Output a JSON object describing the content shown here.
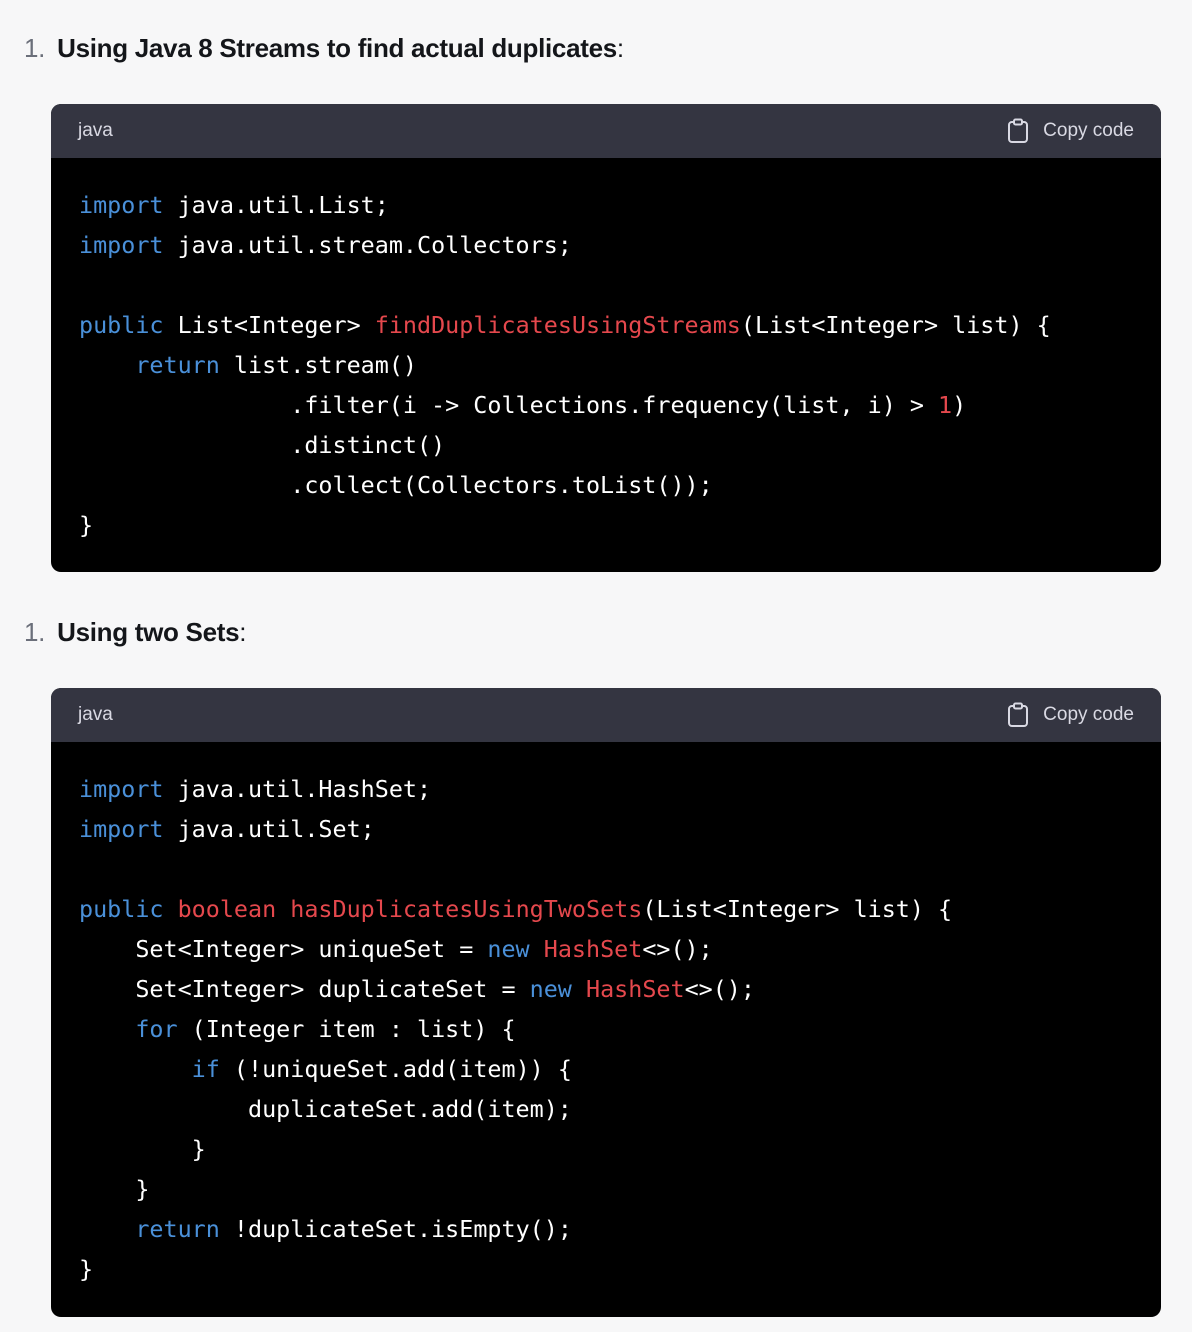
{
  "sections": [
    {
      "number": "1.",
      "title": "Using Java 8 Streams to find actual duplicates",
      "suffix": ":",
      "code": {
        "language": "java",
        "copy_label": "Copy code",
        "lines": [
          [
            {
              "t": "kw",
              "v": "import"
            },
            {
              "t": "tx",
              "v": " java.util.List;"
            }
          ],
          [
            {
              "t": "kw",
              "v": "import"
            },
            {
              "t": "tx",
              "v": " java.util.stream.Collectors;"
            }
          ],
          [],
          [
            {
              "t": "kw",
              "v": "public"
            },
            {
              "t": "tx",
              "v": " List<Integer> "
            },
            {
              "t": "fn",
              "v": "findDuplicatesUsingStreams"
            },
            {
              "t": "tx",
              "v": "(List<Integer> list) {"
            }
          ],
          [
            {
              "t": "tx",
              "v": "    "
            },
            {
              "t": "kw",
              "v": "return"
            },
            {
              "t": "tx",
              "v": " list.stream()"
            }
          ],
          [
            {
              "t": "tx",
              "v": "               .filter(i -> Collections.frequency(list, i) > "
            },
            {
              "t": "num-lit",
              "v": "1"
            },
            {
              "t": "tx",
              "v": ")"
            }
          ],
          [
            {
              "t": "tx",
              "v": "               .distinct()"
            }
          ],
          [
            {
              "t": "tx",
              "v": "               .collect(Collectors.toList());"
            }
          ],
          [
            {
              "t": "tx",
              "v": "}"
            }
          ]
        ]
      }
    },
    {
      "number": "1.",
      "title": "Using two Sets",
      "suffix": ":",
      "code": {
        "language": "java",
        "copy_label": "Copy code",
        "lines": [
          [
            {
              "t": "kw",
              "v": "import"
            },
            {
              "t": "tx",
              "v": " java.util.HashSet;"
            }
          ],
          [
            {
              "t": "kw",
              "v": "import"
            },
            {
              "t": "tx",
              "v": " java.util.Set;"
            }
          ],
          [],
          [
            {
              "t": "kw",
              "v": "public"
            },
            {
              "t": "tx",
              "v": " "
            },
            {
              "t": "fn",
              "v": "boolean"
            },
            {
              "t": "tx",
              "v": " "
            },
            {
              "t": "fn",
              "v": "hasDuplicatesUsingTwoSets"
            },
            {
              "t": "tx",
              "v": "(List<Integer> list) {"
            }
          ],
          [
            {
              "t": "tx",
              "v": "    Set<Integer> uniqueSet = "
            },
            {
              "t": "kw",
              "v": "new"
            },
            {
              "t": "tx",
              "v": " "
            },
            {
              "t": "fn",
              "v": "HashSet"
            },
            {
              "t": "tx",
              "v": "<>();"
            }
          ],
          [
            {
              "t": "tx",
              "v": "    Set<Integer> duplicateSet = "
            },
            {
              "t": "kw",
              "v": "new"
            },
            {
              "t": "tx",
              "v": " "
            },
            {
              "t": "fn",
              "v": "HashSet"
            },
            {
              "t": "tx",
              "v": "<>();"
            }
          ],
          [
            {
              "t": "tx",
              "v": "    "
            },
            {
              "t": "kw",
              "v": "for"
            },
            {
              "t": "tx",
              "v": " (Integer item : list) {"
            }
          ],
          [
            {
              "t": "tx",
              "v": "        "
            },
            {
              "t": "kw",
              "v": "if"
            },
            {
              "t": "tx",
              "v": " (!uniqueSet.add(item)) {"
            }
          ],
          [
            {
              "t": "tx",
              "v": "            duplicateSet.add(item);"
            }
          ],
          [
            {
              "t": "tx",
              "v": "        }"
            }
          ],
          [
            {
              "t": "tx",
              "v": "    }"
            }
          ],
          [
            {
              "t": "tx",
              "v": "    "
            },
            {
              "t": "kw",
              "v": "return"
            },
            {
              "t": "tx",
              "v": " !duplicateSet.isEmpty();"
            }
          ],
          [
            {
              "t": "tx",
              "v": "}"
            }
          ]
        ]
      }
    }
  ]
}
